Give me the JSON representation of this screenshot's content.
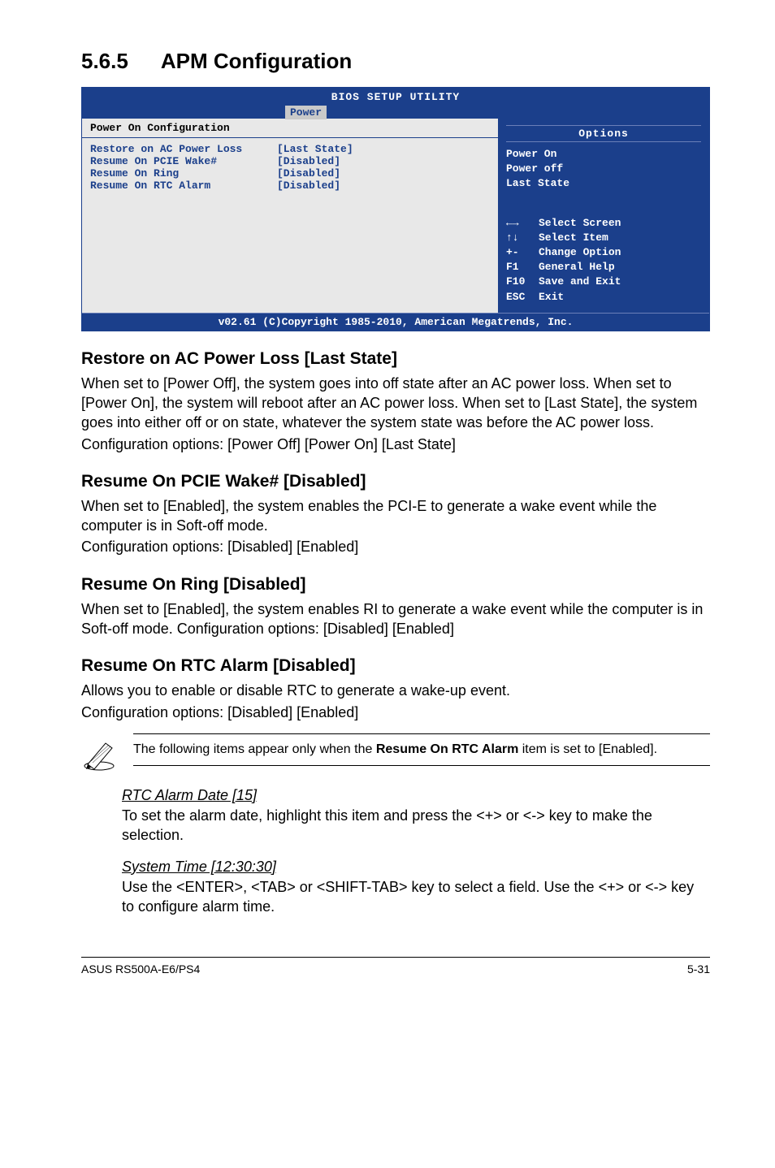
{
  "section": {
    "number": "5.6.5",
    "title": "APM Configuration"
  },
  "bios": {
    "title": "BIOS SETUP UTILITY",
    "active_tab": "Power",
    "left_panel_title": "Power On Configuration",
    "rows": [
      {
        "label": "Restore on AC Power Loss",
        "value": "[Last State]"
      },
      {
        "label": "",
        "value": ""
      },
      {
        "label": "Resume On PCIE Wake#",
        "value": "[Disabled]"
      },
      {
        "label": "Resume On Ring",
        "value": "[Disabled]"
      },
      {
        "label": "Resume On RTC Alarm",
        "value": "[Disabled]"
      }
    ],
    "options_header": "Options",
    "options": [
      "Power On",
      "Power off",
      "Last State"
    ],
    "help": [
      {
        "key": "←→",
        "desc": "Select Screen"
      },
      {
        "key": "↑↓",
        "desc": "Select Item"
      },
      {
        "key": "+-",
        "desc": "Change Option"
      },
      {
        "key": "F1",
        "desc": "General Help"
      },
      {
        "key": "F10",
        "desc": "Save and Exit"
      },
      {
        "key": "ESC",
        "desc": "Exit"
      }
    ],
    "footer": "v02.61 (C)Copyright 1985-2010, American Megatrends, Inc."
  },
  "s1": {
    "h": "Restore on AC Power Loss [Last State]",
    "p1": "When set to [Power Off], the system goes into off state after an AC power loss. When set to [Power On], the system will reboot after an AC power loss. When set to [Last State], the system goes into either off or on state, whatever the system state was before the AC power loss.",
    "p2": "Configuration options: [Power Off] [Power On] [Last State]"
  },
  "s2": {
    "h": "Resume On PCIE Wake# [Disabled]",
    "p1": "When set to [Enabled], the system enables the PCI-E to generate a wake event while the computer is in Soft-off mode.",
    "p2": "Configuration options: [Disabled] [Enabled]"
  },
  "s3": {
    "h": "Resume On Ring [Disabled]",
    "p1": "When set to [Enabled], the system enables RI to generate a wake event while the computer is in Soft-off mode. Configuration options: [Disabled] [Enabled]"
  },
  "s4": {
    "h": "Resume On RTC Alarm [Disabled]",
    "p1": "Allows you to enable or disable RTC to generate a wake-up event.",
    "p2": "Configuration options: [Disabled] [Enabled]"
  },
  "note": {
    "text_a": "The following items appear only when the ",
    "bold": "Resume On RTC Alarm",
    "text_b": " item is set to [Enabled]."
  },
  "sub1": {
    "u": "RTC Alarm Date [15]",
    "p": "To set the alarm date, highlight this item and press the <+> or <-> key to make the selection."
  },
  "sub2": {
    "u": "System Time [12:30:30]",
    "p": "Use the <ENTER>, <TAB> or <SHIFT-TAB> key to select a field. Use the <+> or <-> key to configure alarm time."
  },
  "footer": {
    "left": "ASUS RS500A-E6/PS4",
    "right": "5-31"
  }
}
